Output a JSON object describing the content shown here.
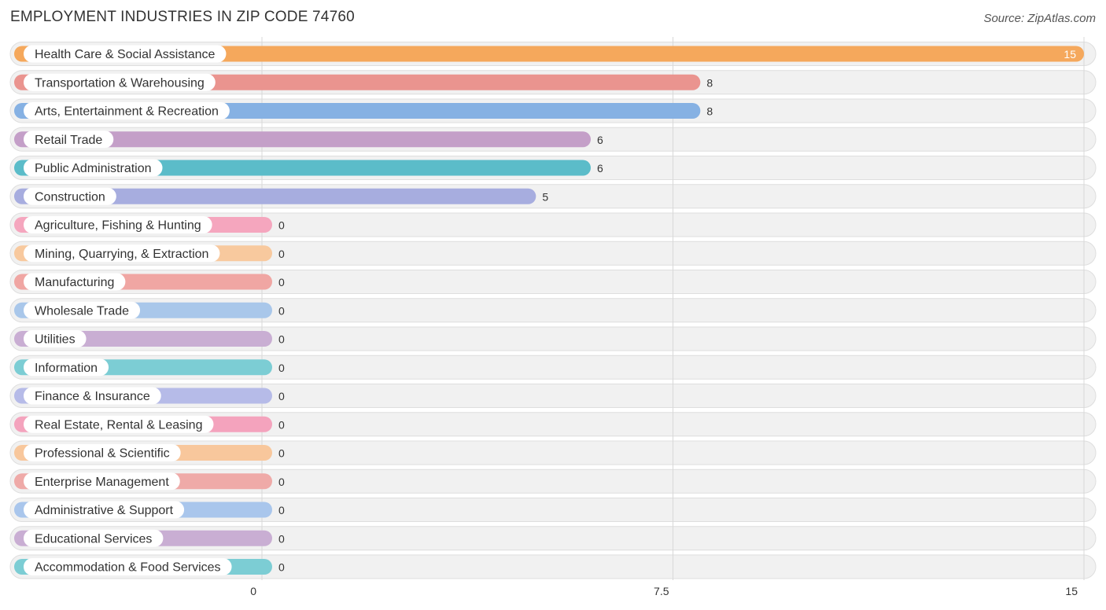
{
  "chart_data": {
    "type": "bar",
    "orientation": "horizontal",
    "title": "EMPLOYMENT INDUSTRIES IN ZIP CODE 74760",
    "source": "Source: ZipAtlas.com",
    "xlim": [
      0,
      15
    ],
    "xticks": [
      {
        "value": 0,
        "label": "0"
      },
      {
        "value": 7.5,
        "label": "7.5"
      },
      {
        "value": 15,
        "label": "15"
      }
    ],
    "grid": true,
    "categories": [
      "Health Care & Social Assistance",
      "Transportation & Warehousing",
      "Arts, Entertainment & Recreation",
      "Retail Trade",
      "Public Administration",
      "Construction",
      "Agriculture, Fishing & Hunting",
      "Mining, Quarrying, & Extraction",
      "Manufacturing",
      "Wholesale Trade",
      "Utilities",
      "Information",
      "Finance & Insurance",
      "Real Estate, Rental & Leasing",
      "Professional & Scientific",
      "Enterprise Management",
      "Administrative & Support",
      "Educational Services",
      "Accommodation & Food Services"
    ],
    "values": [
      15,
      8,
      8,
      6,
      6,
      5,
      0,
      0,
      0,
      0,
      0,
      0,
      0,
      0,
      0,
      0,
      0,
      0,
      0
    ],
    "value_labels": [
      "15",
      "8",
      "8",
      "6",
      "6",
      "5",
      "0",
      "0",
      "0",
      "0",
      "0",
      "0",
      "0",
      "0",
      "0",
      "0",
      "0",
      "0",
      "0"
    ],
    "colors": [
      "#f5a85c",
      "#ea948f",
      "#86b1e3",
      "#c49fc8",
      "#5bbcc9",
      "#a7addf",
      "#f5a6be",
      "#f8c99e",
      "#f0a6a3",
      "#a9c7ea",
      "#c9aed3",
      "#7ccdd4",
      "#b6bbe8",
      "#f4a3bd",
      "#f8c79c",
      "#efaaa8",
      "#a9c6ec",
      "#c9aed3",
      "#7ccdd4"
    ]
  }
}
